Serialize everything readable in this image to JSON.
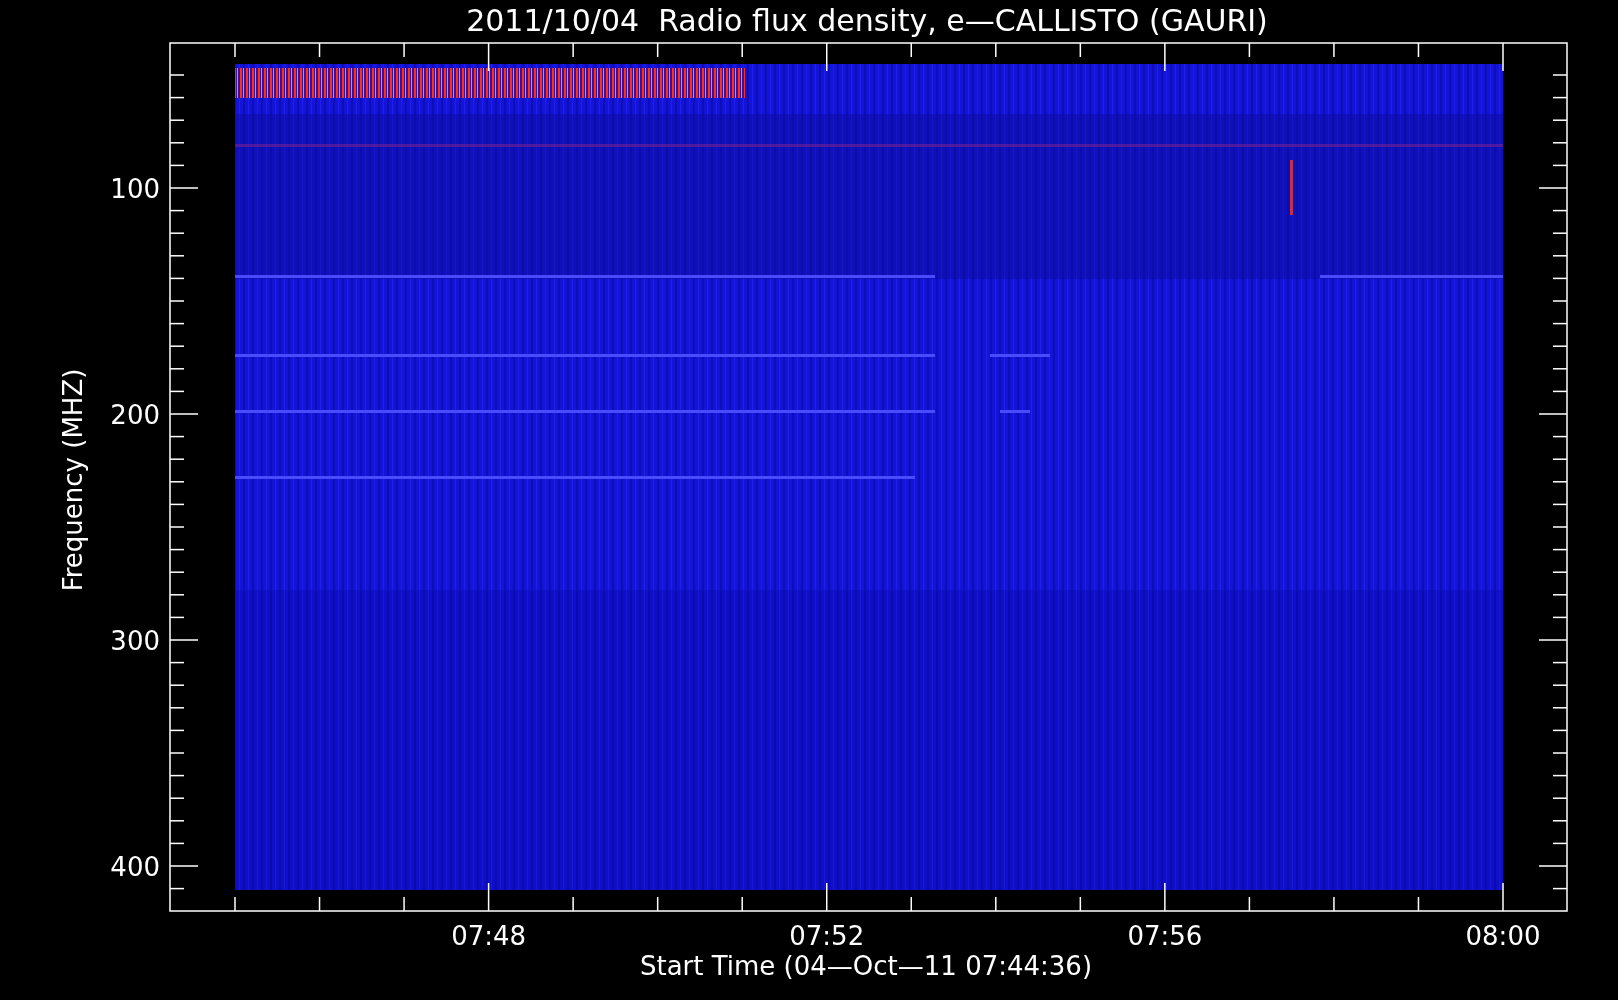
{
  "title": "2011/10/04  Radio flux density, e—CALLISTO (GAURI)",
  "ylabel": "Frequency (MHZ)",
  "xlabel": "Start Time (04—Oct—11 07:44:36)",
  "yticks": [
    {
      "label": "100"
    },
    {
      "label": "200"
    },
    {
      "label": "300"
    },
    {
      "label": "400"
    }
  ],
  "xticks": [
    {
      "label": "07:48"
    },
    {
      "label": "07:52"
    },
    {
      "label": "07:56"
    },
    {
      "label": "08:00"
    }
  ]
}
